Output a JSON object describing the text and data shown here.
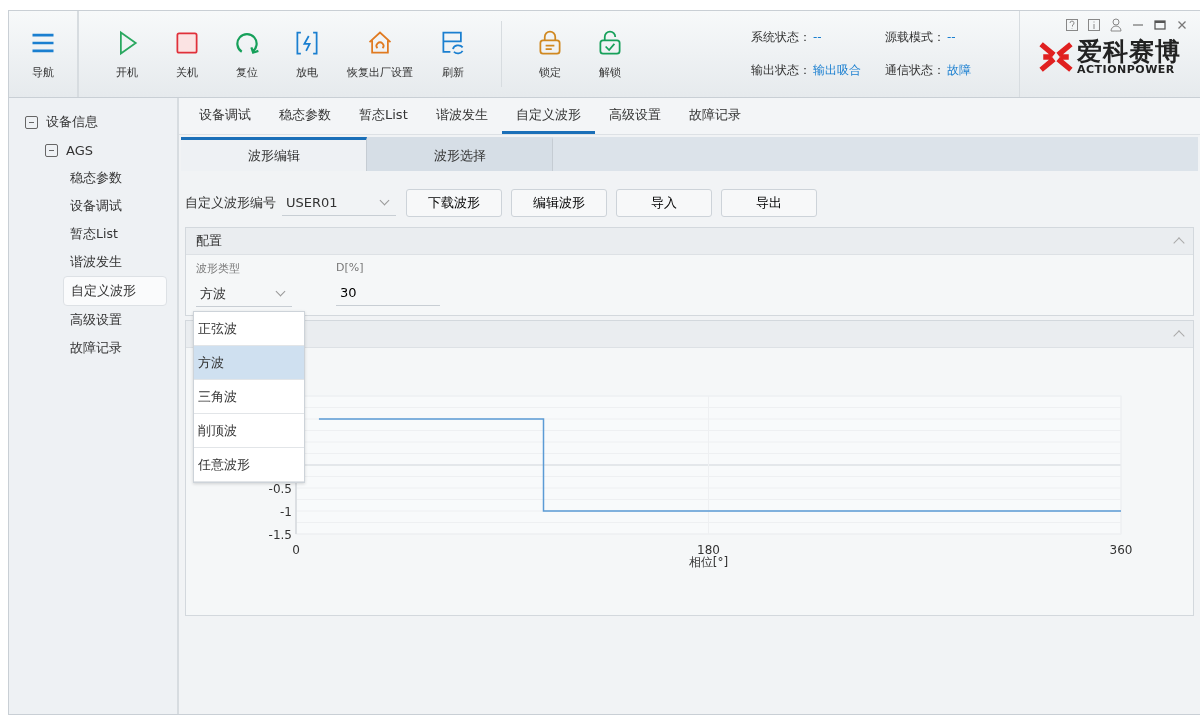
{
  "toolbar": {
    "nav": {
      "label": "导航"
    },
    "buttons": [
      {
        "label": "开机",
        "group_start": false
      },
      {
        "label": "关机",
        "group_start": false
      },
      {
        "label": "复位",
        "group_start": false
      },
      {
        "label": "放电",
        "group_start": false
      },
      {
        "label": "恢复出厂设置",
        "group_start": false
      },
      {
        "label": "刷新",
        "group_start": false
      },
      {
        "label": "锁定",
        "group_start": true
      },
      {
        "label": "解锁",
        "group_start": false
      }
    ],
    "status": [
      {
        "label": "系统状态：",
        "value": "--"
      },
      {
        "label": "源载模式：",
        "value": "--"
      },
      {
        "label": "输出状态：",
        "value": "输出吸合"
      },
      {
        "label": "通信状态：",
        "value": "故障"
      }
    ],
    "logo": {
      "name": "爱科赛博",
      "tagline": "ACTIONPOWER"
    }
  },
  "sidebar": {
    "items": [
      {
        "label": "设备信息",
        "expanded": true,
        "selected": false,
        "children": [
          {
            "label": "AGS",
            "expanded": true,
            "selected": false,
            "children": [
              {
                "label": "稳态参数",
                "selected": false
              },
              {
                "label": "设备调试",
                "selected": false
              },
              {
                "label": "暂态List",
                "selected": false
              },
              {
                "label": "谐波发生",
                "selected": false
              },
              {
                "label": "自定义波形",
                "selected": true
              },
              {
                "label": "高级设置",
                "selected": false
              },
              {
                "label": "故障记录",
                "selected": false
              }
            ]
          }
        ]
      }
    ]
  },
  "tabs": [
    {
      "label": "设备调试",
      "selected": false
    },
    {
      "label": "稳态参数",
      "selected": false
    },
    {
      "label": "暂态List",
      "selected": false
    },
    {
      "label": "谐波发生",
      "selected": false
    },
    {
      "label": "自定义波形",
      "selected": true
    },
    {
      "label": "高级设置",
      "selected": false
    },
    {
      "label": "故障记录",
      "selected": false
    }
  ],
  "subtabs": [
    {
      "label": "波形编辑",
      "selected": true
    },
    {
      "label": "波形选择",
      "selected": false
    }
  ],
  "wave_select": {
    "label": "自定义波形编号",
    "value": "USER01"
  },
  "actions": [
    "下载波形",
    "编辑波形",
    "导入",
    "导出"
  ],
  "config": {
    "title": "配置",
    "type_label": "波形类型",
    "type_value": "方波",
    "d_label": "D[%]",
    "d_value": "30",
    "options": [
      {
        "label": "正弦波",
        "selected": false
      },
      {
        "label": "方波",
        "selected": true
      },
      {
        "label": "三角波",
        "selected": false
      },
      {
        "label": "削顶波",
        "selected": false
      },
      {
        "label": "任意波形",
        "selected": false
      }
    ]
  },
  "chart_panel": {
    "chart_data": {
      "type": "line",
      "xlabel": "相位[°]",
      "x": [
        10,
        108,
        108,
        360
      ],
      "series": [
        {
          "color": "#5b9bd5",
          "values": [
            1,
            1,
            -1,
            -1
          ]
        }
      ],
      "xlim": [
        0,
        360
      ],
      "ylim": [
        -1.5,
        1.5
      ],
      "xticks": [
        0,
        180,
        360
      ],
      "yticks": [
        -1.5,
        -1,
        -0.5
      ]
    }
  }
}
